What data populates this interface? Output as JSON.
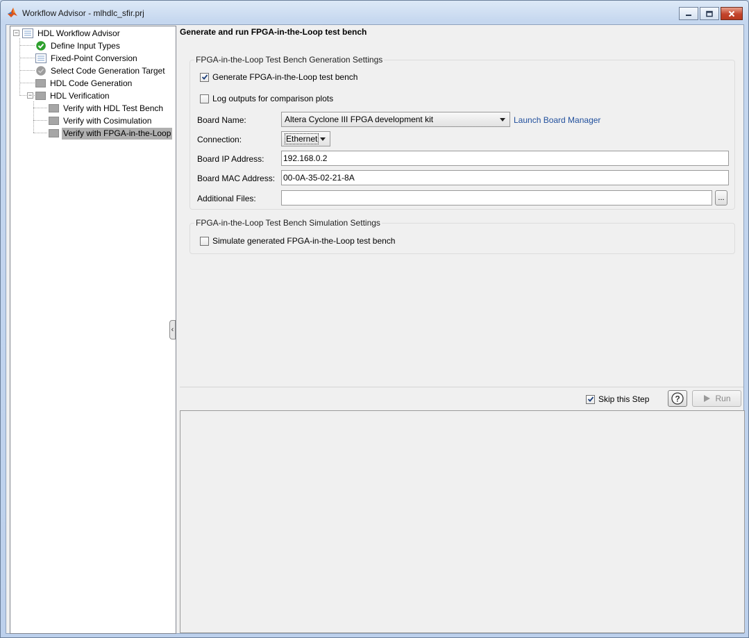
{
  "window": {
    "title": "Workflow Advisor - mlhdlc_sfir.prj",
    "colors": {
      "close": "#c3442c",
      "selection": "#b0b0b0",
      "link": "#1f4e9c"
    }
  },
  "tree": {
    "root": "HDL Workflow Advisor",
    "items": [
      {
        "label": "Define Input Types",
        "icon": "check-pass-icon"
      },
      {
        "label": "Fixed-Point Conversion",
        "icon": "task-list-icon"
      },
      {
        "label": "Select Code Generation Target",
        "icon": "gray-circle-icon"
      },
      {
        "label": "HDL Code Generation",
        "icon": "gray-box-icon"
      },
      {
        "label": "HDL Verification",
        "icon": "gray-box-icon"
      }
    ],
    "verification_items": [
      {
        "label": "Verify with HDL Test Bench",
        "icon": "gray-box-icon"
      },
      {
        "label": "Verify with Cosimulation",
        "icon": "gray-box-icon"
      },
      {
        "label": "Verify with FPGA-in-the-Loop",
        "icon": "gray-box-icon",
        "selected": true
      }
    ]
  },
  "step": {
    "title": "Generate and run FPGA-in-the-Loop test bench",
    "generation": {
      "legend": "FPGA-in-the-Loop Test Bench Generation Settings",
      "generate_tb_label": "Generate FPGA-in-the-Loop test bench",
      "generate_tb_checked": true,
      "log_outputs_label": "Log outputs for comparison plots",
      "log_outputs_checked": false,
      "board_name_label": "Board Name:",
      "board_name_value": "Altera Cyclone III FPGA development kit",
      "launch_board_manager": "Launch Board Manager",
      "connection_label": "Connection:",
      "connection_value": "Ethernet",
      "ip_label": "Board IP Address:",
      "ip_value": "192.168.0.2",
      "mac_label": "Board MAC Address:",
      "mac_value": "00-0A-35-02-21-8A",
      "files_label": "Additional Files:",
      "files_value": "",
      "browse_label": "..."
    },
    "simulation": {
      "legend": "FPGA-in-the-Loop Test Bench Simulation Settings",
      "simulate_label": "Simulate generated FPGA-in-the-Loop test bench",
      "simulate_checked": false
    },
    "footer": {
      "skip_label": "Skip this Step",
      "skip_checked": true,
      "help_label": "?",
      "run_label": "Run"
    }
  }
}
